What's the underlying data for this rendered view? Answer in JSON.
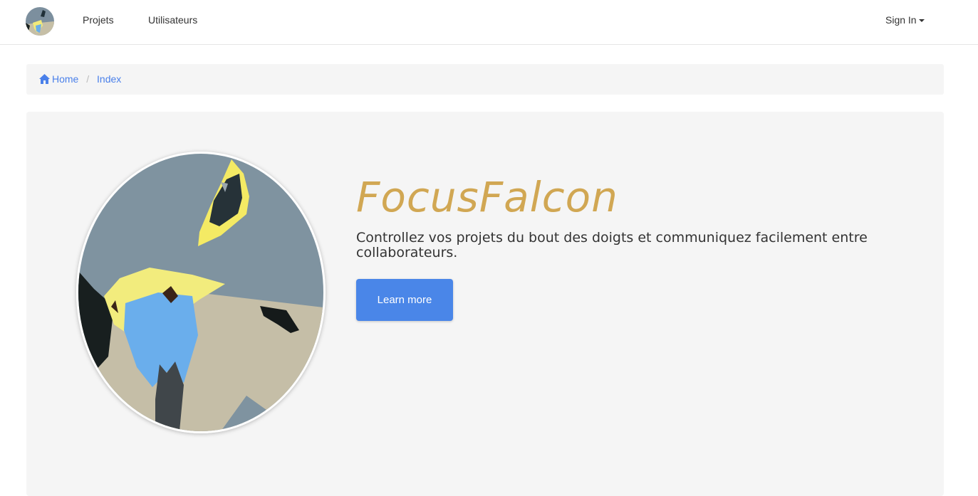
{
  "nav": {
    "logo_icon": "falcon-logo-icon",
    "links": [
      "Projets",
      "Utilisateurs"
    ],
    "signin_label": "Sign In"
  },
  "breadcrumb": {
    "home_label": "Home",
    "current_label": "Index",
    "link_color": "#4a80ea"
  },
  "hero": {
    "title": "FocusFalcon",
    "text": "Controllez vos projets du bout des doigts et communiquez facilement entre collaborateurs.",
    "button_label": "Learn more",
    "title_color": "#d1a753",
    "button_color": "#4a86e8",
    "image_icon": "falcon-illustration"
  }
}
